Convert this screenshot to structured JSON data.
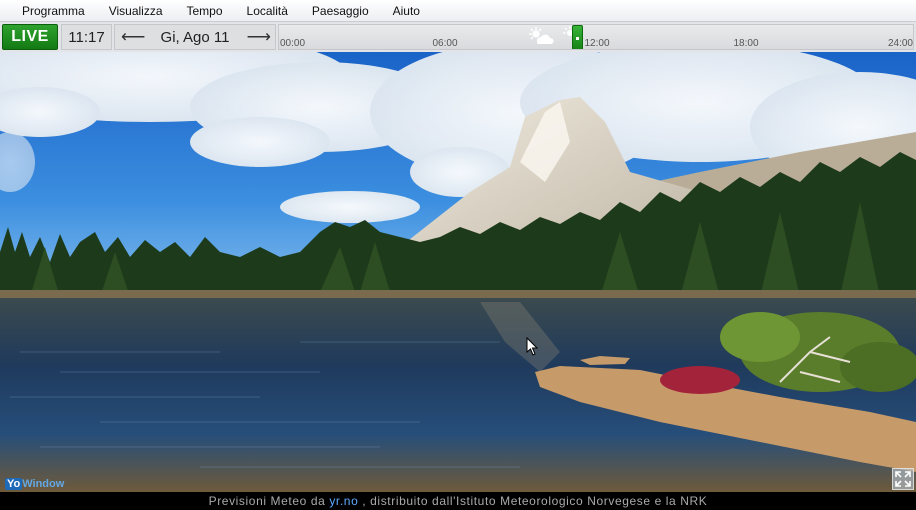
{
  "menu": {
    "items": [
      "Programma",
      "Visualizza",
      "Tempo",
      "Località",
      "Paesaggio",
      "Aiuto"
    ]
  },
  "toolbar": {
    "live_label": "LIVE",
    "time": "11:17",
    "date": "Gi, Ago 11",
    "prev_arrow": "⟵",
    "next_arrow": "⟶",
    "timeline_ticks": [
      "00:00",
      "06:00",
      "12:00",
      "18:00",
      "24:00"
    ],
    "current_fraction": 0.47,
    "accent_color": "#1a8c1a"
  },
  "brand": {
    "part1": "Yo",
    "part2": "Window"
  },
  "footer": {
    "prefix": "Previsioni Meteo da ",
    "link": "yr.no",
    "suffix": ", distribuito dall'Istituto Meteorologico Norvegese e la NRK"
  }
}
